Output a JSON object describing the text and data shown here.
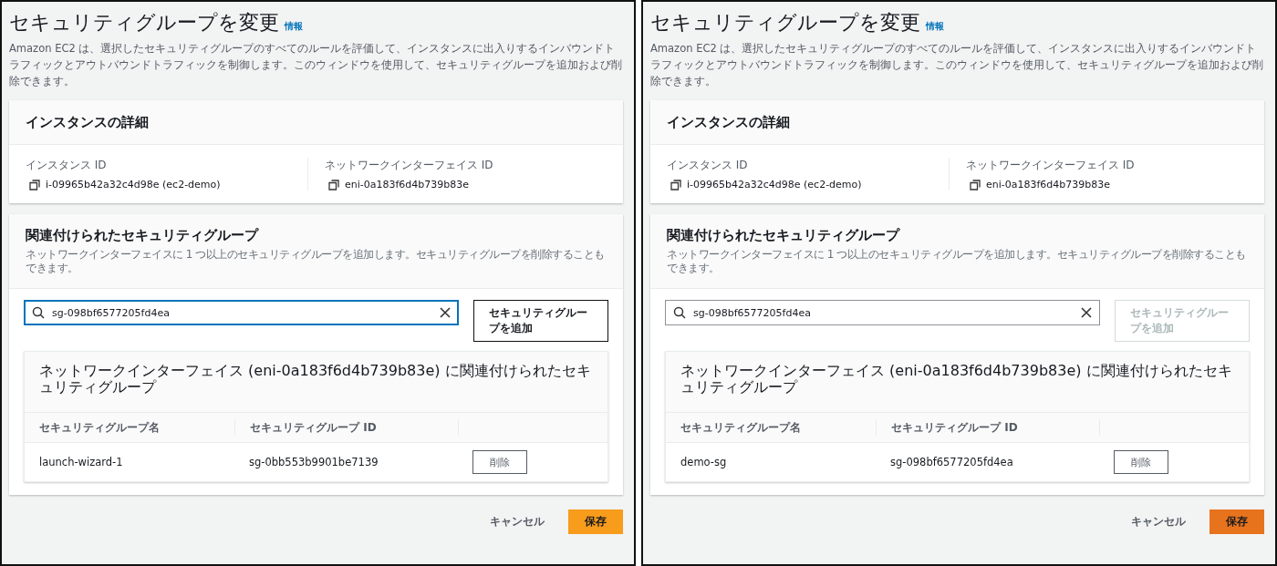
{
  "panels": [
    {
      "title": "セキュリティグループを変更",
      "info_link": "情報",
      "description": "Amazon EC2 は、選択したセキュリティグループのすべてのルールを評価して、インスタンスに出入りするインバウンドトラフィックとアウトバウンドトラフィックを制御します。このウィンドウを使用して、セキュリティグループを追加および削除できます。",
      "instance_details": {
        "title": "インスタンスの詳細",
        "fields": [
          {
            "label": "インスタンス ID",
            "value": "i-09965b42a32c4d98e (ec2-demo)"
          },
          {
            "label": "ネットワークインターフェイス ID",
            "value": "eni-0a183f6d4b739b83e"
          }
        ]
      },
      "security_groups": {
        "title": "関連付けられたセキュリティグループ",
        "description": "ネットワークインターフェイスに 1 つ以上のセキュリティグループを追加します。セキュリティグループを削除することもできます。",
        "search": {
          "value": "sg-098bf6577205fd4ea",
          "focused": true
        },
        "add_button": {
          "label": "セキュリティグループを追加",
          "disabled": false
        },
        "table": {
          "title": "ネットワークインターフェイス (eni-0a183f6d4b739b83e) に関連付けられたセキュリティグループ",
          "columns": [
            "セキュリティグループ名",
            "セキュリティグループ ID"
          ],
          "rows": [
            {
              "name": "launch-wizard-1",
              "id": "sg-0bb553b9901be7139",
              "remove_label": "削除"
            }
          ]
        }
      },
      "footer": {
        "cancel": "キャンセル",
        "save": {
          "label": "保存",
          "hovered": false
        }
      }
    },
    {
      "title": "セキュリティグループを変更",
      "info_link": "情報",
      "description": "Amazon EC2 は、選択したセキュリティグループのすべてのルールを評価して、インスタンスに出入りするインバウンドトラフィックとアウトバウンドトラフィックを制御します。このウィンドウを使用して、セキュリティグループを追加および削除できます。",
      "instance_details": {
        "title": "インスタンスの詳細",
        "fields": [
          {
            "label": "インスタンス ID",
            "value": "i-09965b42a32c4d98e (ec2-demo)"
          },
          {
            "label": "ネットワークインターフェイス ID",
            "value": "eni-0a183f6d4b739b83e"
          }
        ]
      },
      "security_groups": {
        "title": "関連付けられたセキュリティグループ",
        "description": "ネットワークインターフェイスに 1 つ以上のセキュリティグループを追加します。セキュリティグループを削除することもできます。",
        "search": {
          "value": "sg-098bf6577205fd4ea",
          "focused": false
        },
        "add_button": {
          "label": "セキュリティグループを追加",
          "disabled": true
        },
        "table": {
          "title": "ネットワークインターフェイス (eni-0a183f6d4b739b83e) に関連付けられたセキュリティグループ",
          "columns": [
            "セキュリティグループ名",
            "セキュリティグループ ID"
          ],
          "rows": [
            {
              "name": "demo-sg",
              "id": "sg-098bf6577205fd4ea",
              "remove_label": "削除"
            }
          ]
        }
      },
      "footer": {
        "cancel": "キャンセル",
        "save": {
          "label": "保存",
          "hovered": true
        }
      }
    }
  ]
}
